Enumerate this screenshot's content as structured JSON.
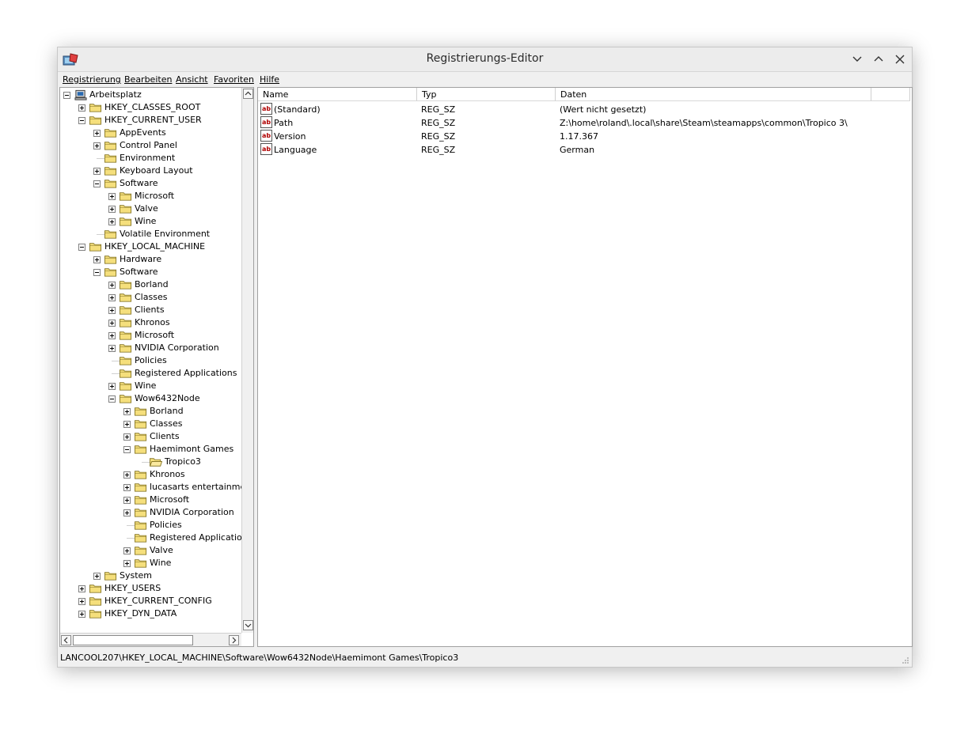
{
  "window": {
    "title": "Registrierungs-Editor"
  },
  "menu": [
    "Registrierung",
    "Bearbeiten",
    "Ansicht",
    "Favoriten",
    "Hilfe"
  ],
  "tree": [
    {
      "label": "Arbeitsplatz",
      "level": 0,
      "expander": "minus",
      "icon": "computer-icon"
    },
    {
      "label": "HKEY_CLASSES_ROOT",
      "level": 1,
      "expander": "plus"
    },
    {
      "label": "HKEY_CURRENT_USER",
      "level": 1,
      "expander": "minus"
    },
    {
      "label": "AppEvents",
      "level": 2,
      "expander": "plus"
    },
    {
      "label": "Control Panel",
      "level": 2,
      "expander": "plus"
    },
    {
      "label": "Environment",
      "level": 2,
      "expander": "none"
    },
    {
      "label": "Keyboard Layout",
      "level": 2,
      "expander": "plus"
    },
    {
      "label": "Software",
      "level": 2,
      "expander": "minus"
    },
    {
      "label": "Microsoft",
      "level": 3,
      "expander": "plus"
    },
    {
      "label": "Valve",
      "level": 3,
      "expander": "plus"
    },
    {
      "label": "Wine",
      "level": 3,
      "expander": "plus"
    },
    {
      "label": "Volatile Environment",
      "level": 2,
      "expander": "none"
    },
    {
      "label": "HKEY_LOCAL_MACHINE",
      "level": 1,
      "expander": "minus"
    },
    {
      "label": "Hardware",
      "level": 2,
      "expander": "plus"
    },
    {
      "label": "Software",
      "level": 2,
      "expander": "minus"
    },
    {
      "label": "Borland",
      "level": 3,
      "expander": "plus"
    },
    {
      "label": "Classes",
      "level": 3,
      "expander": "plus"
    },
    {
      "label": "Clients",
      "level": 3,
      "expander": "plus"
    },
    {
      "label": "Khronos",
      "level": 3,
      "expander": "plus"
    },
    {
      "label": "Microsoft",
      "level": 3,
      "expander": "plus"
    },
    {
      "label": "NVIDIA Corporation",
      "level": 3,
      "expander": "plus"
    },
    {
      "label": "Policies",
      "level": 3,
      "expander": "none"
    },
    {
      "label": "Registered Applications",
      "level": 3,
      "expander": "none"
    },
    {
      "label": "Wine",
      "level": 3,
      "expander": "plus"
    },
    {
      "label": "Wow6432Node",
      "level": 3,
      "expander": "minus"
    },
    {
      "label": "Borland",
      "level": 4,
      "expander": "plus"
    },
    {
      "label": "Classes",
      "level": 4,
      "expander": "plus"
    },
    {
      "label": "Clients",
      "level": 4,
      "expander": "plus"
    },
    {
      "label": "Haemimont Games",
      "level": 4,
      "expander": "minus"
    },
    {
      "label": "Tropico3",
      "level": 5,
      "expander": "none",
      "open": true
    },
    {
      "label": "Khronos",
      "level": 4,
      "expander": "plus"
    },
    {
      "label": "lucasarts entertainment",
      "level": 4,
      "expander": "plus"
    },
    {
      "label": "Microsoft",
      "level": 4,
      "expander": "plus"
    },
    {
      "label": "NVIDIA Corporation",
      "level": 4,
      "expander": "plus"
    },
    {
      "label": "Policies",
      "level": 4,
      "expander": "none"
    },
    {
      "label": "Registered Applications",
      "level": 4,
      "expander": "none"
    },
    {
      "label": "Valve",
      "level": 4,
      "expander": "plus"
    },
    {
      "label": "Wine",
      "level": 4,
      "expander": "plus"
    },
    {
      "label": "System",
      "level": 2,
      "expander": "plus"
    },
    {
      "label": "HKEY_USERS",
      "level": 1,
      "expander": "plus"
    },
    {
      "label": "HKEY_CURRENT_CONFIG",
      "level": 1,
      "expander": "plus"
    },
    {
      "label": "HKEY_DYN_DATA",
      "level": 1,
      "expander": "plus"
    }
  ],
  "list": {
    "columns": [
      "Name",
      "Typ",
      "Daten"
    ],
    "rows": [
      {
        "name": "(Standard)",
        "type": "REG_SZ",
        "data": "(Wert nicht gesetzt)"
      },
      {
        "name": "Path",
        "type": "REG_SZ",
        "data": "Z:\\home\\roland\\.local\\share\\Steam\\steamapps\\common\\Tropico 3\\"
      },
      {
        "name": "Version",
        "type": "REG_SZ",
        "data": "1.17.367"
      },
      {
        "name": "Language",
        "type": "REG_SZ",
        "data": "German"
      }
    ]
  },
  "status": {
    "path": "LANCOOL207\\HKEY_LOCAL_MACHINE\\Software\\Wow6432Node\\Haemimont Games\\Tropico3"
  },
  "colors": {
    "folder": "#f5df7c",
    "folder_stroke": "#8a7a2a",
    "selection": "#000080"
  }
}
